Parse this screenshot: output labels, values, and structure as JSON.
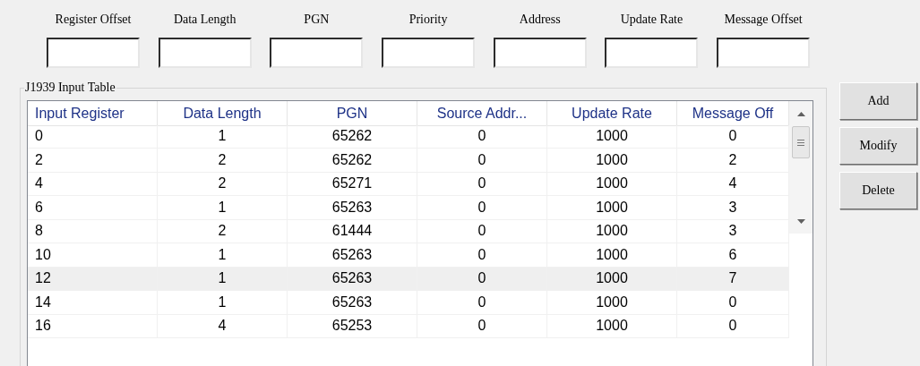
{
  "fields": [
    {
      "label": "Register Offset"
    },
    {
      "label": "Data Length"
    },
    {
      "label": "PGN"
    },
    {
      "label": "Priority"
    },
    {
      "label": "Address"
    },
    {
      "label": "Update Rate"
    },
    {
      "label": "Message Offset"
    }
  ],
  "group_title": "J1939 Input Table",
  "table": {
    "columns": [
      "Input Register",
      "Data Length",
      "PGN",
      "Source Addr...",
      "Update Rate",
      "Message Off"
    ],
    "rows": [
      {
        "cells": [
          "0",
          "1",
          "65262",
          "0",
          "1000",
          "0"
        ],
        "selected": false
      },
      {
        "cells": [
          "2",
          "2",
          "65262",
          "0",
          "1000",
          "2"
        ],
        "selected": false
      },
      {
        "cells": [
          "4",
          "2",
          "65271",
          "0",
          "1000",
          "4"
        ],
        "selected": false
      },
      {
        "cells": [
          "6",
          "1",
          "65263",
          "0",
          "1000",
          "3"
        ],
        "selected": false
      },
      {
        "cells": [
          "8",
          "2",
          "61444",
          "0",
          "1000",
          "3"
        ],
        "selected": false
      },
      {
        "cells": [
          "10",
          "1",
          "65263",
          "0",
          "1000",
          "6"
        ],
        "selected": false
      },
      {
        "cells": [
          "12",
          "1",
          "65263",
          "0",
          "1000",
          "7"
        ],
        "selected": true
      },
      {
        "cells": [
          "14",
          "1",
          "65263",
          "0",
          "1000",
          "0"
        ],
        "selected": false
      },
      {
        "cells": [
          "16",
          "4",
          "65253",
          "0",
          "1000",
          "0"
        ],
        "selected": false
      }
    ]
  },
  "buttons": [
    "Add",
    "Modify",
    "Delete"
  ]
}
